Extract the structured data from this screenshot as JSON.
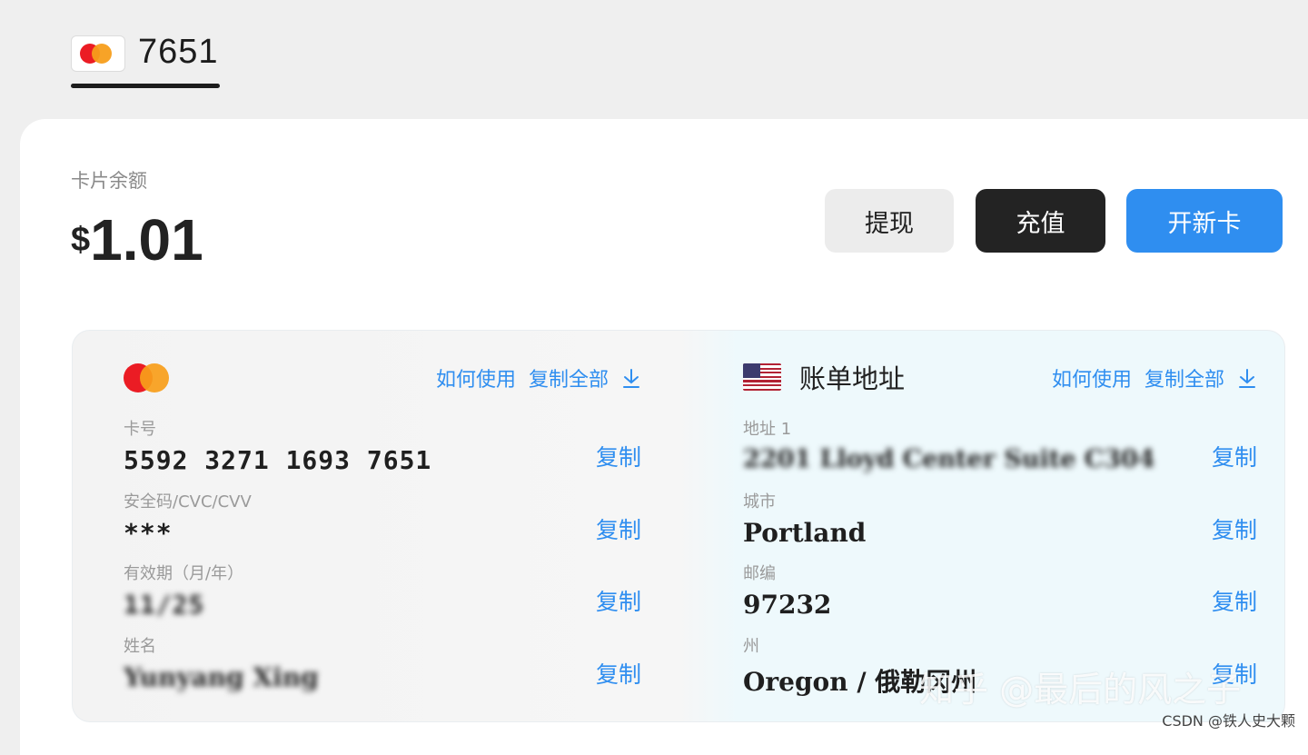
{
  "tab": {
    "card_last4": "7651"
  },
  "balance": {
    "label": "卡片余额",
    "currency_symbol": "$",
    "amount": "1.01"
  },
  "buttons": {
    "withdraw": "提现",
    "top_up": "充值",
    "new_card": "开新卡"
  },
  "card_info": {
    "how_to_use": "如何使用",
    "copy_all": "复制全部",
    "fields": [
      {
        "label": "卡号",
        "value": "5592 3271 1693 7651",
        "copy": "复制"
      },
      {
        "label": "安全码/CVC/CVV",
        "value": "***",
        "copy": "复制"
      },
      {
        "label": "有效期（月/年）",
        "value": "11/25",
        "copy": "复制"
      },
      {
        "label": "姓名",
        "value": "Yunyang Xing",
        "copy": "复制"
      }
    ]
  },
  "billing": {
    "title": "账单地址",
    "how_to_use": "如何使用",
    "copy_all": "复制全部",
    "fields": [
      {
        "label": "地址 1",
        "value": "2201 Lloyd Center Suite C304",
        "copy": "复制"
      },
      {
        "label": "城市",
        "value": "Portland",
        "copy": "复制"
      },
      {
        "label": "邮编",
        "value": "97232",
        "copy": "复制"
      },
      {
        "label": "州",
        "value": "Oregon / 俄勒冈州",
        "copy": "复制"
      }
    ]
  },
  "watermarks": {
    "zhihu": "知乎 @最后的风之子",
    "csdn": "CSDN @铁人史大颗"
  },
  "colors": {
    "accent": "#2f8ef0",
    "dark_button": "#232323",
    "mc_red": "#eb1c24",
    "mc_orange": "#f79e1b"
  },
  "icons": {
    "card_brand": "mastercard-icon",
    "flag": "us-flag-icon",
    "download": "download-icon"
  }
}
